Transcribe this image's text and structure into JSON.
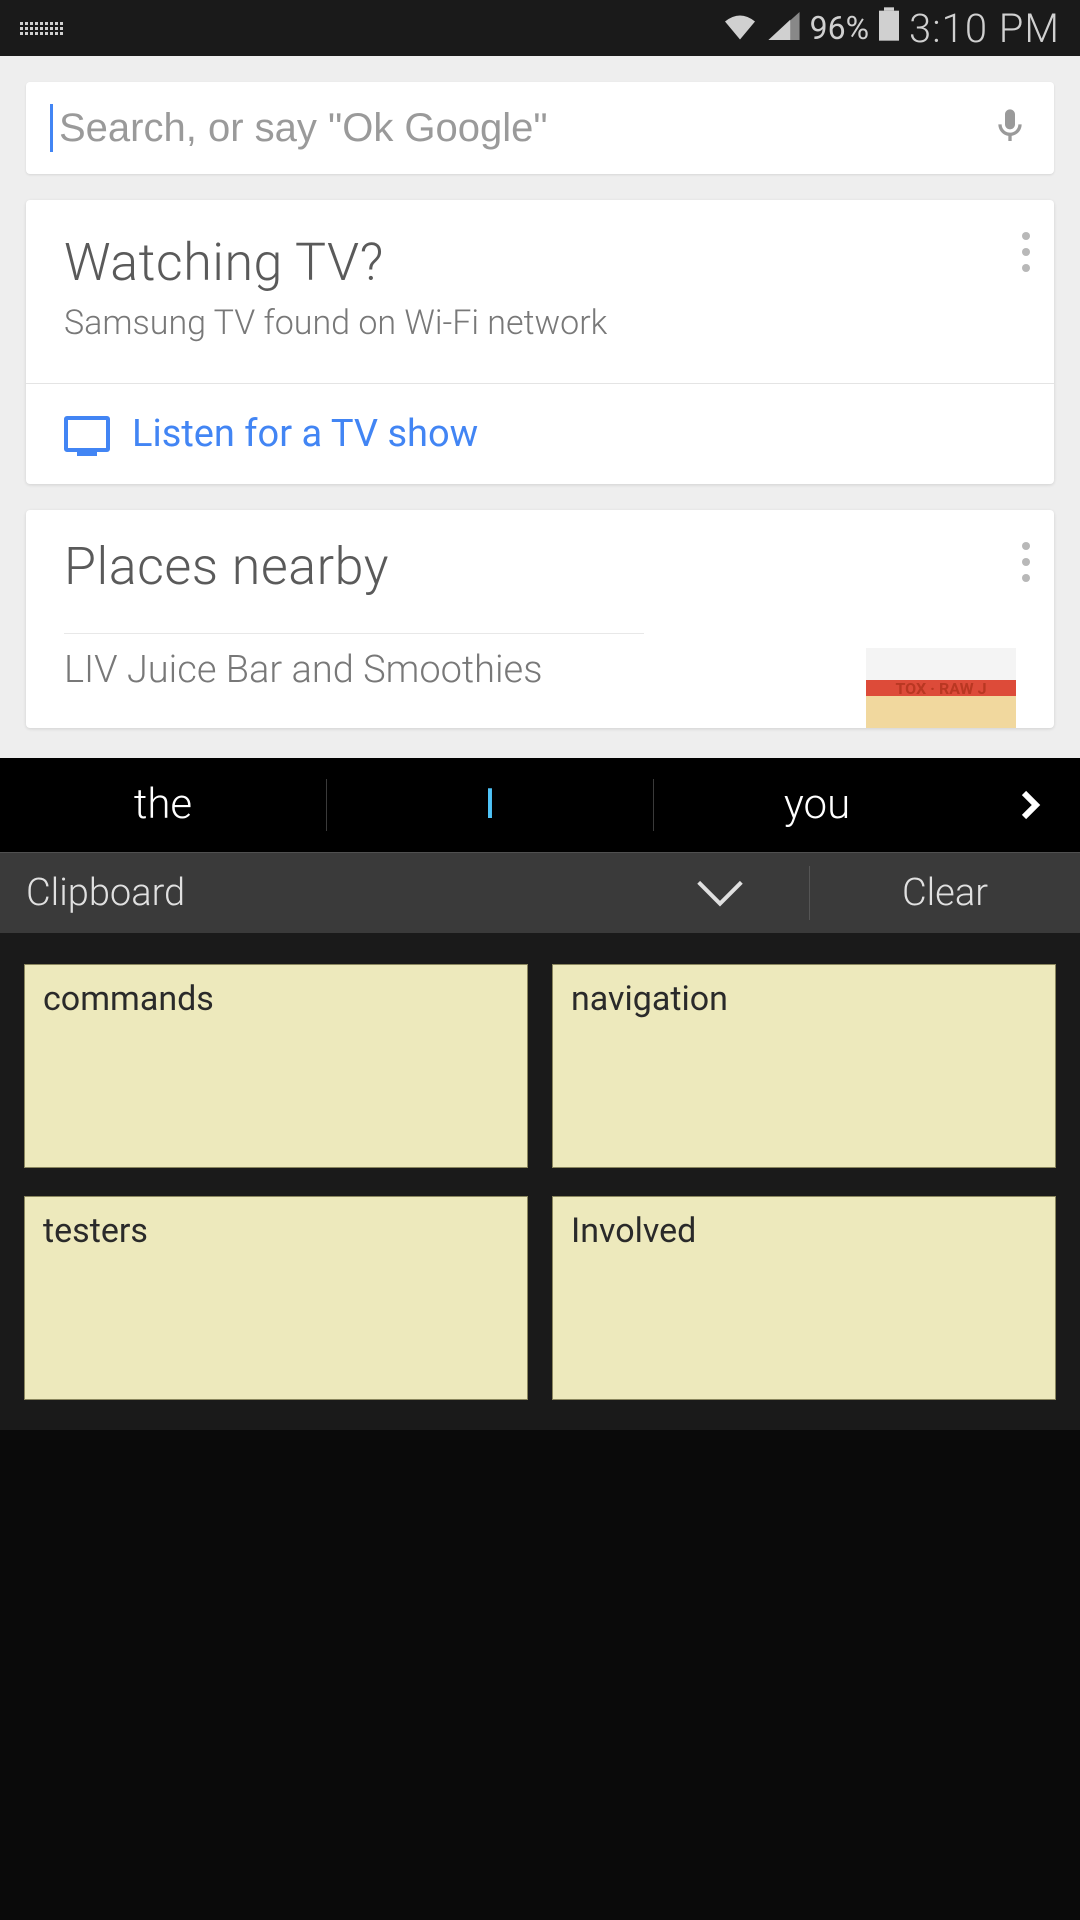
{
  "status": {
    "battery": "96%",
    "time": "3:10 PM"
  },
  "search": {
    "placeholder": "Search, or say \"Ok Google\""
  },
  "tv_card": {
    "title": "Watching TV?",
    "subtitle": "Samsung TV found on Wi-Fi network",
    "action": "Listen for a TV show"
  },
  "places_card": {
    "title": "Places nearby",
    "item": "LIV Juice Bar and Smoothies",
    "img_text": "TOX · RAW J"
  },
  "suggestions": {
    "s1": "the",
    "s2": "I",
    "s3": "you"
  },
  "clipboard": {
    "label": "Clipboard",
    "clear": "Clear",
    "items": [
      "commands",
      "navigation",
      "testers",
      "Involved"
    ]
  }
}
